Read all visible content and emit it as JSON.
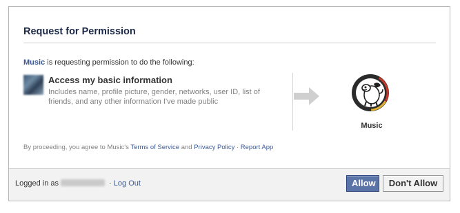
{
  "dialog": {
    "title": "Request for Permission",
    "intro_app": "Music",
    "intro_text": " is requesting permission to do the following:",
    "permission": {
      "title": "Access my basic information",
      "description": "Includes name, profile picture, gender, networks, user ID, list of friends, and any other information I've made public"
    },
    "app": {
      "name": "Music",
      "icon": "music-app-logo-icon"
    },
    "legal": {
      "prefix": "By proceeding, you agree to Music's ",
      "terms": "Terms of Service",
      "and": " and ",
      "privacy": "Privacy Policy",
      "separator": " · ",
      "report": "Report App"
    }
  },
  "footer": {
    "logged_prefix": "Logged in as",
    "logged_separator": " · ",
    "logout": "Log Out",
    "allow": "Allow",
    "deny": "Don't Allow"
  },
  "colors": {
    "link": "#3b5998",
    "allow_button": "#5b74a8",
    "title": "#1c2a47"
  }
}
